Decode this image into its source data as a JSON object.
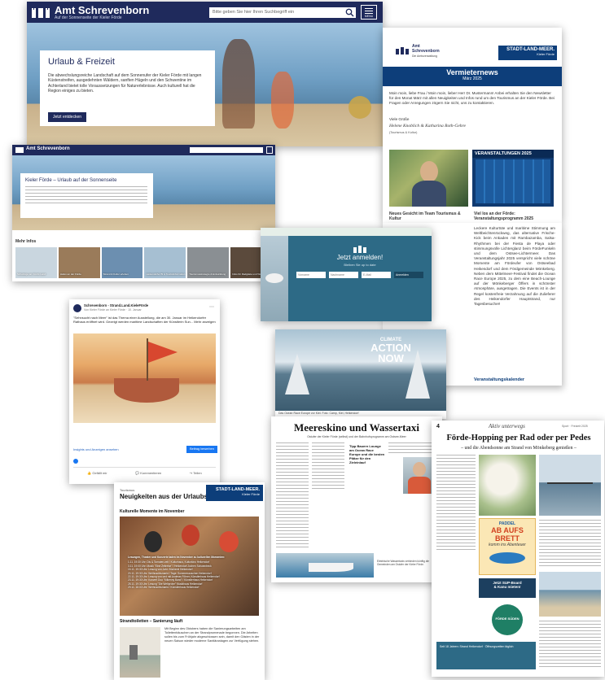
{
  "site1": {
    "brand": "Amt Schrevenborn",
    "tagline": "Auf der Sonnenseite der Kieler Förde",
    "search_placeholder": "Bitte geben Sie hier Ihren Suchbegriff ein",
    "menu_label": "MENU",
    "hero_title": "Urlaub & Freizeit",
    "hero_text": "Die abwechslungsreiche Landschaft auf dem Sonnenufer der Kieler Förde mit langen Küstenstreifen, ausgedehnten Wäldern, sanften Hügeln und den Schwentine im Achterland bietet tolle Voraussetzungen für Naturerlebnisse. Auch kulturell hat die Region einiges zu bieten.",
    "hero_button": "Jetzt entdecken"
  },
  "site2": {
    "brand": "Amt Schrevenborn",
    "title": "Kieler Förde – Urlaub auf der Sonnenseite",
    "more_label": "Mehr Infos",
    "tiles": [
      "Schwänge am Fords Land",
      "Hafen an der Förde",
      "Strand & Kultur erleben",
      "Heikendorfer Bl & Touristinformation",
      "Tourismusstrategie & Entwicklung",
      "Infos für Radgäste und Wanderer"
    ]
  },
  "newsletter": {
    "logo_text": "Amt Schrevenborn",
    "logo_sub": "Die Amtsverwaltung",
    "badge_line1": "STADT-LAND-MEER.",
    "badge_line2": "Kieler Förde",
    "title": "Vermieternews",
    "date": "März 2025",
    "intro": "Moin moin, liebe Frau / Moin moin, lieber Herr Dr. Mustermann! Anbei erhalten Sie den Newsletter für den Monat März mit allen Neuigkeiten und Infos rund um den Tourismus an der Kieler Förde. Bei Fragen oder Anregungen zögern Sie nicht, uns zu kontaktieren.",
    "greeting": "Viele Grüße",
    "sign": "Helene Knoblich & Katharina Roth-Gehre",
    "dept": "(Tourismus & Kultur)",
    "events_banner": "VERANSTALTUNGEN 2025",
    "col1_title": "Neues Gesicht im Team Tourismus & Kultur",
    "col2_title": "Viel los an der Förde: Veranstaltungsprogramm 2025",
    "col2_text": "Leckere Kulturtüte und maritime Stimmung am Weltbeichtenrückweg, das alternative Frische-Kick beim Ankaden mit Rambazamba, Salsa-Rhythmen bei der Fiesta de Playa oder stimmungsvolle Lichterglanz beim FördeFunkeln und dem Ostsee-Lichtermeer. Das Veranstaltungsjahr 2025 verspricht viele schöne Momente am Fördeufer von Ostseebad Heikendorf und dem Fördgemeinde Mönkeberg. Neben dem Mittelmeer-Festival findet die Ocean Race Europe 2025, zu dem eine Beach-Lounge auf der Mönkeberger Öffers in schönster Atmosphäre, ausgetragen. Die Events ist in der Regel kostenfreie Verzahnung auf die Zulieferer des Heikendorfer Hauptstrand, nur Tagesbesucher!",
    "col2_link": "Veranstaltungskalender",
    "col1_link": "agement"
  },
  "signup": {
    "title": "Jetzt anmelden!",
    "subtitle": "Bleiben Sie up to date",
    "fields": [
      "Vorname",
      "Nachname",
      "E-Mail"
    ],
    "button": "Anmelden"
  },
  "sail": {
    "sign1": "CLIMATE",
    "sign2": "ACTION",
    "sign3": "NOW",
    "caption": "Das Ocean Race Europe vor Kiel. Foto: Camp, Kiel, Heikendorf"
  },
  "facebook": {
    "page": "Schrevenborn - Strand.Land.KieleFörde",
    "meta": "Von Kieler Förde an Kieler Förde · 10. Januar",
    "text": "\"Sehnsucht nach Meer\" ist das Thema einer Ausstellung, die am 30. Januar im Heikendorfer Rathaus eröffnet wird. Gezeigt werden maritime Landschaften der Künstlerin Sun... Mehr anzeigen",
    "ads_link": "Insights und Anzeigen ansehen",
    "boost": "Beitrag bewerben",
    "like": "Gefällt mir",
    "comment": "Kommentieren",
    "share": "Teilen"
  },
  "news2": {
    "tag": "Tourismus",
    "title": "Neuigkeiten aus der Urlaubsregion",
    "badge_line1": "STADT-LAND-MEER.",
    "badge_line2": "Kieler Förde",
    "section1": "Kulturelle Momente im November",
    "overlay_title": "Lesungen, Theater und Konzerte laden im November zu kulturellen Momenten:",
    "overlay_lines": [
      "1.11. 19:30 Uhr: Dis & Tomaten.zeit / Kulturhaus, Kulturkino Heikendorf",
      "3.11. 19:00 Uhr: Musik \"Eine Zeitreise\" / Heikendorf Jochen Schwanbeck",
      "15.11. 19:30 Uhr: Lesung von Jahr: Bücherei Heikendorf",
      "20.11. 19:30 Uhr: Weihnachtsmarkt / Tage: Sommerrauschen Heikendorf",
      "22.11. 19:30 Uhr: Lesung von und mit Andreas Föhrer, Künstlerhaus Heikendorf",
      "23.11. 19:30 Uhr: Konzert Duo \"Kilkenny Band\" / Künstlerhaus Heikendorf",
      "28.11. 19:30 Uhr: Lesung \"Die Weltprobe\" Musikhaus Heikendorf",
      "29.11. 18:00 Uhr: Weihnachtsmarkt / Künstlerhaus Heikendorf"
    ],
    "section2": "Strandtoiletten – Sanierung läuft",
    "section2_text": "Mit Beginn des Oktobers haben die Sanierungsarbeiten am Toilettenhäuschen an der Strandpromenade begonnen. Die Arbeiten sollen bis zum Frühjahr abgeschlossen sein, damit den Gästen in der neuen Saison wieder moderne Sanitäranlagen zur Verfügung stehen."
  },
  "newspaper1": {
    "title": "Meereskino und Wassertaxi",
    "subtitle": "Ostufer der Kieler Förde (selbst) und der Bahnhofsprogramm am Ostsee-Meer",
    "callout": "Tipp Bauern Lounge am Ocean Race Europe und die besten Plätze für den Zieleinlauf",
    "caption": "Elektrische Wassertaxis verbinden künftig die Gemeinden am Ostufer der Kieler Förde."
  },
  "newspaper2": {
    "kicker": "Aktiv unterwegs",
    "page": "4",
    "side": "Sport · Freizeit 2025",
    "title": "Förde-Hopping per Rad oder per Pedes",
    "subtitle": "– und die Abendsonne am Strand von Mönkeberg genießen –",
    "ad_line1": "PADDEL",
    "ad_line2": "AB AUFS BRETT",
    "ad_line3": "komm ins Abenteuer",
    "ad2_line1": "Jetzt SUP-Board",
    "ad2_line2": "& Kanu mieten!",
    "ad3": "Seit 18 Jahren: Strand Heikendorf · Öffnungszeiten täglich",
    "badge": "FÖRDE SÜDEN"
  },
  "colors": {
    "navy": "#1f2a5c",
    "teal": "#2d6a86",
    "mint": "#c8dfd4",
    "newsblue": "#0d3e7a"
  }
}
